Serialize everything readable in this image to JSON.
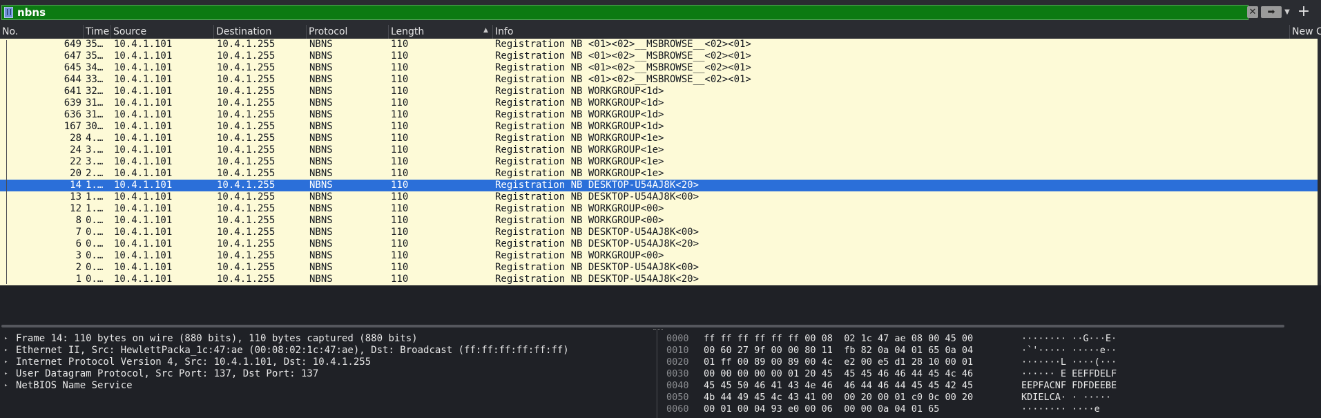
{
  "filter": {
    "value": "nbns",
    "clear_icon": "clear-x-icon",
    "apply_icon": "arrow-right-icon",
    "dropdown_icon": "chevron-down-icon",
    "add_icon": "plus-icon"
  },
  "columns": [
    {
      "label": "No."
    },
    {
      "label": "Time"
    },
    {
      "label": "Source"
    },
    {
      "label": "Destination"
    },
    {
      "label": "Protocol"
    },
    {
      "label": "Length"
    },
    {
      "label": "Info"
    },
    {
      "label": "New C"
    }
  ],
  "packets": [
    {
      "no": "649",
      "time": "35…",
      "src": "10.4.1.101",
      "dst": "10.4.1.255",
      "proto": "NBNS",
      "len": "110",
      "info": "Registration NB <01><02>__MSBROWSE__<02><01>"
    },
    {
      "no": "647",
      "time": "35…",
      "src": "10.4.1.101",
      "dst": "10.4.1.255",
      "proto": "NBNS",
      "len": "110",
      "info": "Registration NB <01><02>__MSBROWSE__<02><01>"
    },
    {
      "no": "645",
      "time": "34…",
      "src": "10.4.1.101",
      "dst": "10.4.1.255",
      "proto": "NBNS",
      "len": "110",
      "info": "Registration NB <01><02>__MSBROWSE__<02><01>"
    },
    {
      "no": "644",
      "time": "33…",
      "src": "10.4.1.101",
      "dst": "10.4.1.255",
      "proto": "NBNS",
      "len": "110",
      "info": "Registration NB <01><02>__MSBROWSE__<02><01>"
    },
    {
      "no": "641",
      "time": "32…",
      "src": "10.4.1.101",
      "dst": "10.4.1.255",
      "proto": "NBNS",
      "len": "110",
      "info": "Registration NB WORKGROUP<1d>"
    },
    {
      "no": "639",
      "time": "31…",
      "src": "10.4.1.101",
      "dst": "10.4.1.255",
      "proto": "NBNS",
      "len": "110",
      "info": "Registration NB WORKGROUP<1d>"
    },
    {
      "no": "636",
      "time": "31…",
      "src": "10.4.1.101",
      "dst": "10.4.1.255",
      "proto": "NBNS",
      "len": "110",
      "info": "Registration NB WORKGROUP<1d>"
    },
    {
      "no": "167",
      "time": "30…",
      "src": "10.4.1.101",
      "dst": "10.4.1.255",
      "proto": "NBNS",
      "len": "110",
      "info": "Registration NB WORKGROUP<1d>"
    },
    {
      "no": "28",
      "time": "4.…",
      "src": "10.4.1.101",
      "dst": "10.4.1.255",
      "proto": "NBNS",
      "len": "110",
      "info": "Registration NB WORKGROUP<1e>"
    },
    {
      "no": "24",
      "time": "3.…",
      "src": "10.4.1.101",
      "dst": "10.4.1.255",
      "proto": "NBNS",
      "len": "110",
      "info": "Registration NB WORKGROUP<1e>"
    },
    {
      "no": "22",
      "time": "3.…",
      "src": "10.4.1.101",
      "dst": "10.4.1.255",
      "proto": "NBNS",
      "len": "110",
      "info": "Registration NB WORKGROUP<1e>"
    },
    {
      "no": "20",
      "time": "2.…",
      "src": "10.4.1.101",
      "dst": "10.4.1.255",
      "proto": "NBNS",
      "len": "110",
      "info": "Registration NB WORKGROUP<1e>"
    },
    {
      "no": "14",
      "time": "1.…",
      "src": "10.4.1.101",
      "dst": "10.4.1.255",
      "proto": "NBNS",
      "len": "110",
      "info": "Registration NB DESKTOP-U54AJ8K<20>",
      "selected": true
    },
    {
      "no": "13",
      "time": "1.…",
      "src": "10.4.1.101",
      "dst": "10.4.1.255",
      "proto": "NBNS",
      "len": "110",
      "info": "Registration NB DESKTOP-U54AJ8K<00>"
    },
    {
      "no": "12",
      "time": "1.…",
      "src": "10.4.1.101",
      "dst": "10.4.1.255",
      "proto": "NBNS",
      "len": "110",
      "info": "Registration NB WORKGROUP<00>"
    },
    {
      "no": "8",
      "time": "0.…",
      "src": "10.4.1.101",
      "dst": "10.4.1.255",
      "proto": "NBNS",
      "len": "110",
      "info": "Registration NB WORKGROUP<00>"
    },
    {
      "no": "7",
      "time": "0.…",
      "src": "10.4.1.101",
      "dst": "10.4.1.255",
      "proto": "NBNS",
      "len": "110",
      "info": "Registration NB DESKTOP-U54AJ8K<00>"
    },
    {
      "no": "6",
      "time": "0.…",
      "src": "10.4.1.101",
      "dst": "10.4.1.255",
      "proto": "NBNS",
      "len": "110",
      "info": "Registration NB DESKTOP-U54AJ8K<20>"
    },
    {
      "no": "3",
      "time": "0.…",
      "src": "10.4.1.101",
      "dst": "10.4.1.255",
      "proto": "NBNS",
      "len": "110",
      "info": "Registration NB WORKGROUP<00>"
    },
    {
      "no": "2",
      "time": "0.…",
      "src": "10.4.1.101",
      "dst": "10.4.1.255",
      "proto": "NBNS",
      "len": "110",
      "info": "Registration NB DESKTOP-U54AJ8K<00>"
    },
    {
      "no": "1",
      "time": "0.…",
      "src": "10.4.1.101",
      "dst": "10.4.1.255",
      "proto": "NBNS",
      "len": "110",
      "info": "Registration NB DESKTOP-U54AJ8K<20>"
    }
  ],
  "details": [
    "Frame 14: 110 bytes on wire (880 bits), 110 bytes captured (880 bits)",
    "Ethernet II, Src: HewlettPacka_1c:47:ae (00:08:02:1c:47:ae), Dst: Broadcast (ff:ff:ff:ff:ff:ff)",
    "Internet Protocol Version 4, Src: 10.4.1.101, Dst: 10.4.1.255",
    "User Datagram Protocol, Src Port: 137, Dst Port: 137",
    "NetBIOS Name Service"
  ],
  "hex": [
    {
      "offset": "0000",
      "bytes": "ff ff ff ff ff ff 00 08  02 1c 47 ae 08 00 45 00",
      "ascii": "········ ··G···E·"
    },
    {
      "offset": "0010",
      "bytes": "00 60 27 9f 00 00 80 11  fb 82 0a 04 01 65 0a 04",
      "ascii": "·`'····· ·····e··"
    },
    {
      "offset": "0020",
      "bytes": "01 ff 00 89 00 89 00 4c  e2 00 e5 d1 28 10 00 01",
      "ascii": "·······L ····(···"
    },
    {
      "offset": "0030",
      "bytes": "00 00 00 00 00 01 20 45  45 45 46 46 44 45 4c 46",
      "ascii": "······ E EEFFDELF"
    },
    {
      "offset": "0040",
      "bytes": "45 45 50 46 41 43 4e 46  46 44 46 44 45 45 42 45",
      "ascii": "EEPFACNF FDFDEEBE"
    },
    {
      "offset": "0050",
      "bytes": "4b 44 49 45 4c 43 41 00  00 20 00 01 c0 0c 00 20",
      "ascii": "KDIELCA· · ····· "
    },
    {
      "offset": "0060",
      "bytes": "00 01 00 04 93 e0 00 06  00 00 0a 04 01 65",
      "ascii": "········ ····e"
    }
  ],
  "colors": {
    "filter_valid": "#0c7a12",
    "row_nbns": "#fdfad7",
    "row_selected": "#2b6fd9"
  }
}
